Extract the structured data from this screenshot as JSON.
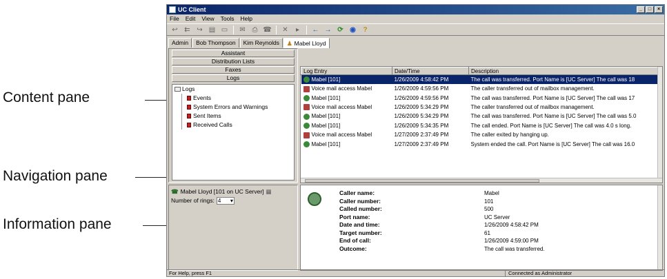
{
  "callouts": {
    "content": "Content pane",
    "navigation": "Navigation pane",
    "information": "Information pane"
  },
  "window": {
    "title": "UC Client",
    "controls": [
      "_",
      "□",
      "×"
    ]
  },
  "menu": [
    "File",
    "Edit",
    "View",
    "Tools",
    "Help"
  ],
  "toolbar_icons": [
    "reply-icon",
    "reply-all-icon",
    "forward-icon",
    "file-icon",
    "folder-icon",
    "mail-icon",
    "print-icon",
    "phone-icon",
    "delete-icon",
    "play-icon",
    "back-arrow-icon",
    "forward-arrow-icon",
    "refresh-icon",
    "globe-icon",
    "help-icon"
  ],
  "tabs": [
    "Admin",
    "Bob Thompson",
    "Kim Reynolds",
    "Mabel Lloyd"
  ],
  "nav": {
    "buttons": [
      "Assistant",
      "Distribution Lists",
      "Faxes",
      "Logs"
    ],
    "tree_root": "Logs",
    "tree_items": [
      "Events",
      "System Errors and Warnings",
      "Sent Items",
      "Received Calls"
    ]
  },
  "user_info": {
    "line": "Mabel Lloyd [101 on UC Server]",
    "rings_label": "Number of rings:",
    "rings_value": "4"
  },
  "log": {
    "columns": [
      "Log Entry",
      "Date/Time",
      "Description"
    ],
    "rows": [
      {
        "entry": "Mabel [101]",
        "time": "1/26/2009 4:58:42 PM",
        "desc": "The call was transferred. Port Name is [UC Server] The call was 18",
        "kind": "call"
      },
      {
        "entry": "Voice mail access Mabel",
        "time": "1/26/2009 4:59:56 PM",
        "desc": "The caller transferred out of mailbox management.",
        "kind": "vm"
      },
      {
        "entry": "Mabel [101]",
        "time": "1/26/2009 4:59:56 PM",
        "desc": "The call was transferred. Port Name is [UC Server] The call was 17",
        "kind": "call"
      },
      {
        "entry": "Voice mail access Mabel",
        "time": "1/26/2009 5:34:29 PM",
        "desc": "The caller transferred out of mailbox management.",
        "kind": "vm"
      },
      {
        "entry": "Mabel [101]",
        "time": "1/26/2009 5:34:29 PM",
        "desc": "The call was transferred. Port Name is [UC Server] The call was 5.0",
        "kind": "call"
      },
      {
        "entry": "Mabel [101]",
        "time": "1/26/2009 5:34:35 PM",
        "desc": "The call ended. Port Name is [UC Server] The call was 4.0 s long.",
        "kind": "call"
      },
      {
        "entry": "Voice mail access Mabel",
        "time": "1/27/2009 2:37:49 PM",
        "desc": "The caller exited by hanging up.",
        "kind": "vm"
      },
      {
        "entry": "Mabel [101]",
        "time": "1/27/2009 2:37:49 PM",
        "desc": "System ended the call. Port Name is [UC Server] The call was 16.0",
        "kind": "call"
      }
    ]
  },
  "details": [
    {
      "k": "Caller name:",
      "v": "Mabel"
    },
    {
      "k": "Caller number:",
      "v": "101"
    },
    {
      "k": "Called number:",
      "v": "500"
    },
    {
      "k": "Port name:",
      "v": "UC Server"
    },
    {
      "k": "Date and time:",
      "v": "1/26/2009 4:58:42 PM"
    },
    {
      "k": "Target number:",
      "v": "61"
    },
    {
      "k": "End of call:",
      "v": "1/26/2009 4:59:00 PM"
    },
    {
      "k": "Outcome:",
      "v": "The call was transferred."
    }
  ],
  "status": {
    "left": "For Help, press F1",
    "right": "Connected as Administrator"
  }
}
